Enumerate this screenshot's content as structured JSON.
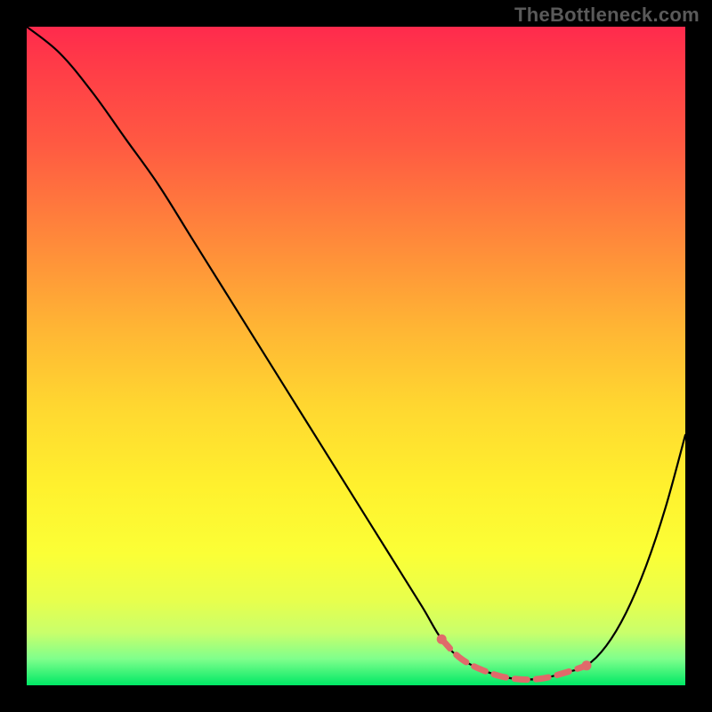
{
  "watermark": "TheBottleneck.com",
  "chart_data": {
    "type": "line",
    "title": "",
    "xlabel": "",
    "ylabel": "",
    "xlim": [
      0,
      100
    ],
    "ylim": [
      0,
      100
    ],
    "grid": false,
    "series": [
      {
        "name": "curve",
        "color": "#000000",
        "x": [
          0,
          5,
          10,
          15,
          20,
          25,
          30,
          35,
          40,
          45,
          50,
          55,
          60,
          63,
          66,
          70,
          74,
          78,
          82,
          85,
          88,
          91,
          94,
          97,
          100
        ],
        "y": [
          100,
          96,
          90,
          83,
          76,
          68,
          60,
          52,
          44,
          36,
          28,
          20,
          12,
          7,
          4,
          2,
          1,
          1,
          2,
          3,
          6,
          11,
          18,
          27,
          38
        ]
      },
      {
        "name": "highlight",
        "color": "#e06a6a",
        "x": [
          63,
          66,
          70,
          74,
          78,
          82,
          85
        ],
        "y": [
          7,
          4,
          2,
          1,
          1,
          2,
          3
        ]
      }
    ],
    "gradient_stops": [
      {
        "pos": 0,
        "color": "#ff2a4d"
      },
      {
        "pos": 18,
        "color": "#ff5a42"
      },
      {
        "pos": 46,
        "color": "#ffb634"
      },
      {
        "pos": 70,
        "color": "#fff12e"
      },
      {
        "pos": 92,
        "color": "#c9ff6b"
      },
      {
        "pos": 100,
        "color": "#00e865"
      }
    ]
  }
}
